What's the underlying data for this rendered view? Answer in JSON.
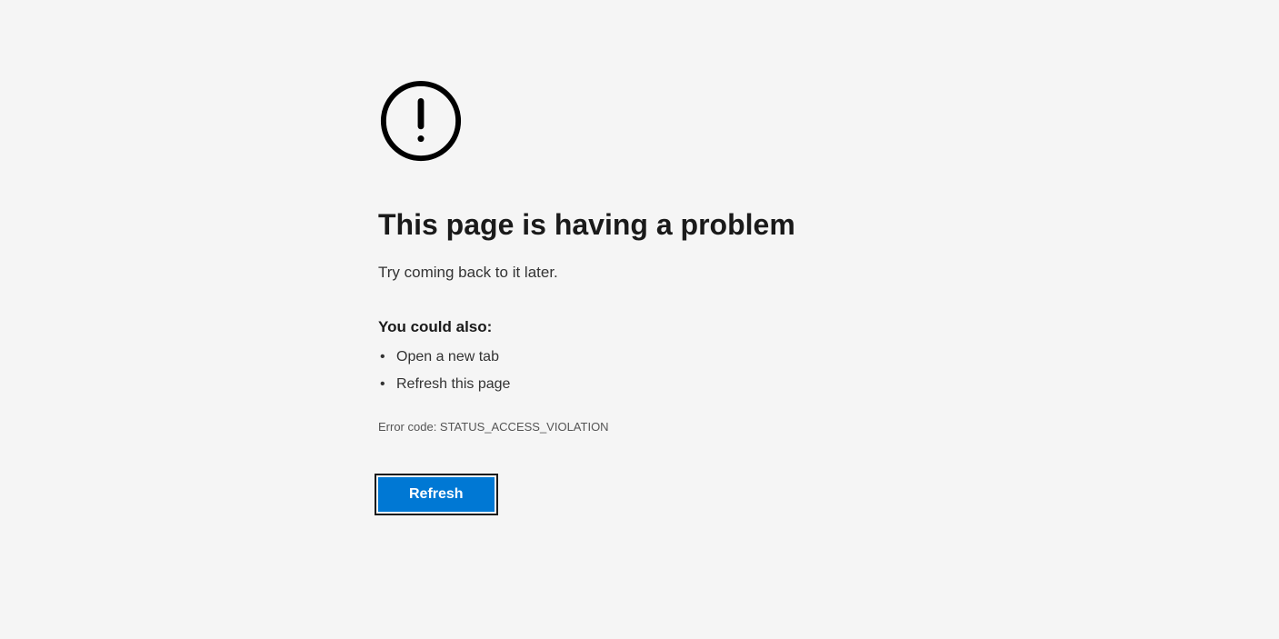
{
  "error": {
    "heading": "This page is having a problem",
    "subtext": "Try coming back to it later.",
    "also_heading": "You could also:",
    "suggestions": [
      "Open a new tab",
      "Refresh this page"
    ],
    "error_code": "Error code: STATUS_ACCESS_VIOLATION",
    "refresh_label": "Refresh"
  }
}
